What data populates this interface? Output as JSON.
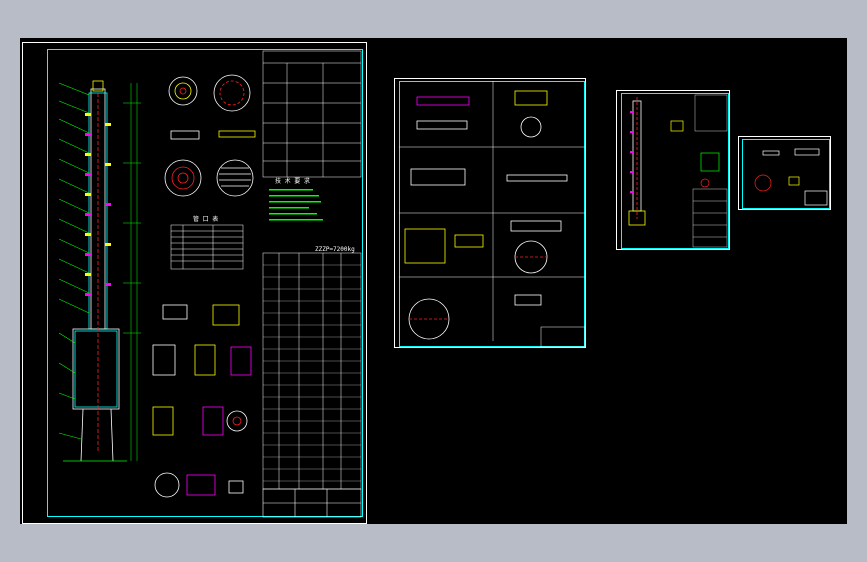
{
  "viewport": {
    "background": "#000000",
    "frame_color": "#b8bcc6"
  },
  "colors": {
    "cyan": "#00ffff",
    "green": "#00ff00",
    "yellow": "#ffff00",
    "magenta": "#ff00ff",
    "red": "#ff2020",
    "white": "#ffffff",
    "blue": "#3060ff"
  },
  "sheets": [
    {
      "id": "main-assembly",
      "label": ""
    },
    {
      "id": "parts-sheet",
      "label": ""
    },
    {
      "id": "small-assembly",
      "label": ""
    },
    {
      "id": "detail-sheet",
      "label": ""
    }
  ],
  "main_sheet": {
    "mass_note": "ZZZP=7200kg",
    "tech_note_title": "技 术 要 求",
    "nozzle_table_title": "管 口 表"
  }
}
